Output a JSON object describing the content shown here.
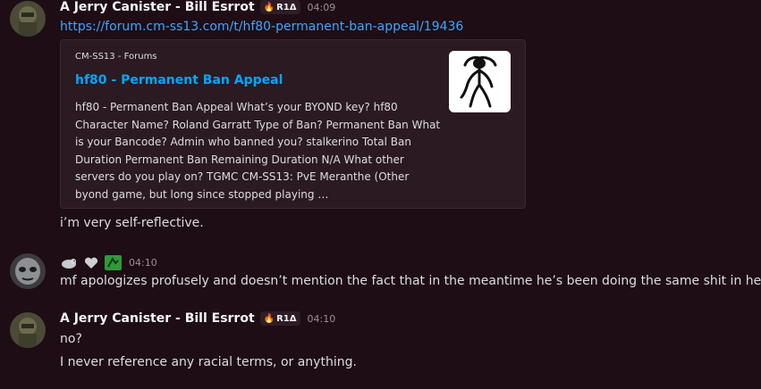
{
  "messages": [
    {
      "author": "A Jerry Canister - Bill Esrrot",
      "role_tag": "R1Δ",
      "timestamp": "04:09",
      "link": "https://forum.cm-ss13.com/t/hf80-permanent-ban-appeal/19436",
      "embed": {
        "provider": "CM-SS13 - Forums",
        "title": "hf80 - Permanent Ban Appeal",
        "description": "hf80 - Permanent Ban Appeal What’s your BYOND key? hf80 Character Name? Roland Garratt Type of Ban? Permanent Ban What is your Bancode? Admin who banned you? stalkerino Total Ban Duration Permanent Ban Remaining Duration N/A What other servers do you play on? TGMC CM-SS13: PvE Meranthe (Other byond game, but long since stopped playing …"
      },
      "followup_text": "i’m very self-reflective."
    },
    {
      "author_emojis": [
        "seal-emoji",
        "heart-emoji",
        "plant-emoji"
      ],
      "timestamp": "04:10",
      "text": "mf apologizes profusely and doesn’t mention the fact that in the meantime he’s been doing the same shit in here"
    },
    {
      "author": "A Jerry Canister - Bill Esrrot",
      "role_tag": "R1Δ",
      "timestamp": "04:10",
      "lines": [
        "no?",
        "I never reference any racial terms, or anything."
      ]
    }
  ],
  "colors": {
    "background": "#1e0d14",
    "link": "#3ea6ff",
    "embed_title": "#00a8fc",
    "embed_bg": "#2b1a22"
  }
}
